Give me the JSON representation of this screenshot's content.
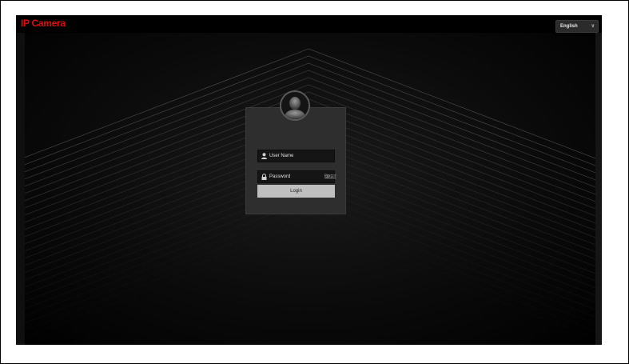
{
  "app": {
    "title": "IP Camera"
  },
  "colors": {
    "brand": "#e00b0b",
    "background": "#000000",
    "card": "#2e2e2e",
    "button": "#bfbfbf"
  },
  "language": {
    "selected": "English",
    "icon": "chevron-down-icon"
  },
  "login": {
    "avatar_icon": "user-avatar-icon",
    "username": {
      "placeholder": "User Name",
      "value": "",
      "icon": "user-icon"
    },
    "password": {
      "placeholder": "Password",
      "value": "",
      "icon": "lock-icon",
      "toggle_icon": "eye-icon"
    },
    "forgot_label": "Forgot",
    "login_label": "Login"
  }
}
